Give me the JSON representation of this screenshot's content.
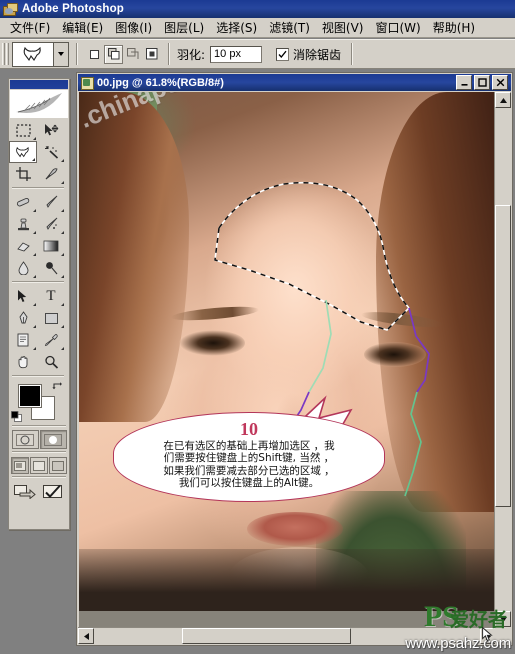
{
  "app": {
    "title": "Adobe Photoshop",
    "icon": "photoshop-app-icon"
  },
  "menubar": {
    "items": [
      {
        "label": "文件(F)",
        "name": "menu-file"
      },
      {
        "label": "编辑(E)",
        "name": "menu-edit"
      },
      {
        "label": "图像(I)",
        "name": "menu-image"
      },
      {
        "label": "图层(L)",
        "name": "menu-layer"
      },
      {
        "label": "选择(S)",
        "name": "menu-select"
      },
      {
        "label": "滤镜(T)",
        "name": "menu-filter"
      },
      {
        "label": "视图(V)",
        "name": "menu-view"
      },
      {
        "label": "窗口(W)",
        "name": "menu-window"
      },
      {
        "label": "帮助(H)",
        "name": "menu-help"
      }
    ]
  },
  "options_bar": {
    "tool_preset_icon": "lasso-tool-icon",
    "preset_dropdown_icon": "chevron-down-icon",
    "selection_modes": [
      {
        "name": "new-selection",
        "icon": "new-selection-icon",
        "active": false
      },
      {
        "name": "add-to-selection",
        "icon": "add-to-selection-icon",
        "active": true
      },
      {
        "name": "subtract-from-selection",
        "icon": "subtract-from-selection-icon",
        "active": false
      },
      {
        "name": "intersect-selection",
        "icon": "intersect-selection-icon",
        "active": false
      }
    ],
    "feather_label": "羽化:",
    "feather_value": "10 px",
    "antialias_label": "消除锯齿",
    "antialias_checked": true
  },
  "toolbox": {
    "tools": [
      {
        "name": "rectangular-marquee-tool",
        "icon": "marquee-icon",
        "selected": false,
        "has_flyout": true
      },
      {
        "name": "move-tool",
        "icon": "move-icon",
        "selected": false,
        "has_flyout": false
      },
      {
        "name": "lasso-tool",
        "icon": "lasso-icon",
        "selected": true,
        "has_flyout": true
      },
      {
        "name": "magic-wand-tool",
        "icon": "magic-wand-icon",
        "selected": false,
        "has_flyout": true
      },
      {
        "name": "crop-tool",
        "icon": "crop-icon",
        "selected": false,
        "has_flyout": false
      },
      {
        "name": "slice-tool",
        "icon": "slice-icon",
        "selected": false,
        "has_flyout": true
      },
      {
        "name": "healing-brush-tool",
        "icon": "healing-brush-icon",
        "selected": false,
        "has_flyout": true
      },
      {
        "name": "brush-tool",
        "icon": "brush-icon",
        "selected": false,
        "has_flyout": true
      },
      {
        "name": "clone-stamp-tool",
        "icon": "clone-stamp-icon",
        "selected": false,
        "has_flyout": true
      },
      {
        "name": "history-brush-tool",
        "icon": "history-brush-icon",
        "selected": false,
        "has_flyout": true
      },
      {
        "name": "eraser-tool",
        "icon": "eraser-icon",
        "selected": false,
        "has_flyout": true
      },
      {
        "name": "gradient-tool",
        "icon": "gradient-icon",
        "selected": false,
        "has_flyout": true
      },
      {
        "name": "blur-tool",
        "icon": "blur-drop-icon",
        "selected": false,
        "has_flyout": true
      },
      {
        "name": "dodge-tool",
        "icon": "dodge-icon",
        "selected": false,
        "has_flyout": true
      },
      {
        "name": "path-selection-tool",
        "icon": "path-arrow-icon",
        "selected": false,
        "has_flyout": true
      },
      {
        "name": "type-tool",
        "icon": "type-t-icon",
        "selected": false,
        "has_flyout": true
      },
      {
        "name": "pen-tool",
        "icon": "pen-icon",
        "selected": false,
        "has_flyout": true
      },
      {
        "name": "shape-tool",
        "icon": "rectangle-shape-icon",
        "selected": false,
        "has_flyout": true
      },
      {
        "name": "notes-tool",
        "icon": "notes-icon",
        "selected": false,
        "has_flyout": true
      },
      {
        "name": "eyedropper-tool",
        "icon": "eyedropper-icon",
        "selected": false,
        "has_flyout": true
      },
      {
        "name": "hand-tool",
        "icon": "hand-icon",
        "selected": false,
        "has_flyout": false
      },
      {
        "name": "zoom-tool",
        "icon": "magnifier-icon",
        "selected": false,
        "has_flyout": false
      }
    ],
    "foreground_color": "#000000",
    "background_color": "#ffffff",
    "swap_colors_icon": "swap-colors-icon",
    "default_colors_icon": "default-colors-icon",
    "quick_mask": [
      {
        "name": "standard-mode-button",
        "icon": "standard-mode-icon",
        "active": false
      },
      {
        "name": "quick-mask-mode-button",
        "icon": "quick-mask-icon",
        "active": true
      }
    ],
    "screen_modes": [
      {
        "name": "standard-screen-mode",
        "icon": "standard-screen-icon",
        "active": true
      },
      {
        "name": "full-screen-menubar-mode",
        "icon": "full-screen-menu-icon",
        "active": false
      },
      {
        "name": "full-screen-mode",
        "icon": "full-screen-icon",
        "active": false
      }
    ],
    "jump_buttons": [
      {
        "name": "jump-to-imageready-button",
        "icon": "jump-to-imageready-icon"
      },
      {
        "name": "edit-in-imageready-button",
        "icon": "checkmark-icon"
      }
    ]
  },
  "document": {
    "title": "00.jpg @ 61.8%(RGB/8#)",
    "icon": "image-document-icon",
    "window_buttons": [
      {
        "name": "minimize-button",
        "glyph": "_"
      },
      {
        "name": "maximize-button",
        "glyph": "❐"
      },
      {
        "name": "close-button",
        "glyph": "✕"
      }
    ],
    "zoom_percent": "61.8%",
    "color_mode": "RGB/8#",
    "filename": "00.jpg",
    "image_watermark": ".chinaps.net",
    "scrollbars": {
      "vertical": {
        "name": "vertical-scrollbar",
        "up_icon": "triangle-up-icon",
        "down_icon": "triangle-down-icon"
      },
      "horizontal": {
        "name": "horizontal-scrollbar",
        "left_icon": "triangle-left-icon",
        "right_icon": "triangle-right-icon"
      }
    }
  },
  "callout": {
    "number": "10",
    "lines": [
      "在已有选区的基础上再增加选区 ，我",
      "们需要按住键盘上的Shift键, 当然 ，",
      "如果我们需要减去部分已选的区域 ，",
      "我们可以按住键盘上的Alt键。"
    ],
    "border_color": "#b3365a",
    "number_color": "#c0385c"
  },
  "page_watermark": {
    "brand": "PS",
    "brand_cn": "爱好者",
    "url": "www.psahz.com",
    "brand_color": "#2f7a2c"
  }
}
